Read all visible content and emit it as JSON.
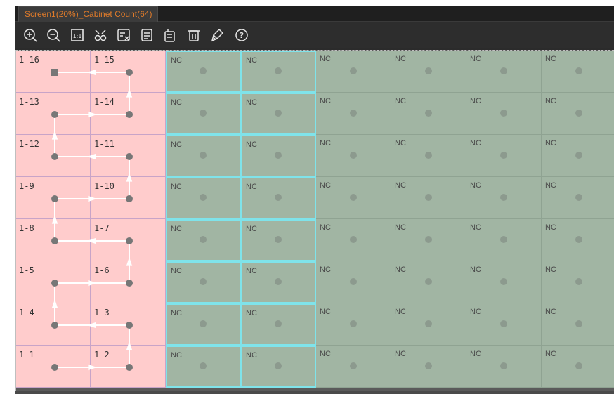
{
  "tab": {
    "title": "Screen1(20%)_Cabinet Count(64)"
  },
  "toolbar": {
    "icons": [
      "zoom-in-icon",
      "zoom-out-icon",
      "actual-size-icon",
      "shape-icon",
      "clear-icon",
      "list-icon",
      "copy-icon",
      "delete-icon",
      "brush-icon",
      "help-icon"
    ]
  },
  "grid": {
    "assigned_rows": [
      [
        "1-16",
        "1-15"
      ],
      [
        "1-13",
        "1-14"
      ],
      [
        "1-12",
        "1-11"
      ],
      [
        "1-9",
        "1-10"
      ],
      [
        "1-8",
        "1-7"
      ],
      [
        "1-5",
        "1-6"
      ],
      [
        "1-4",
        "1-3"
      ],
      [
        "1-1",
        "1-2"
      ]
    ],
    "nc_label": "NC"
  },
  "colors": {
    "assigned": "#ffcccc",
    "unassigned": "#a1b5a3",
    "highlight": "#7fe3ea",
    "tab_text": "#e07b2a"
  }
}
